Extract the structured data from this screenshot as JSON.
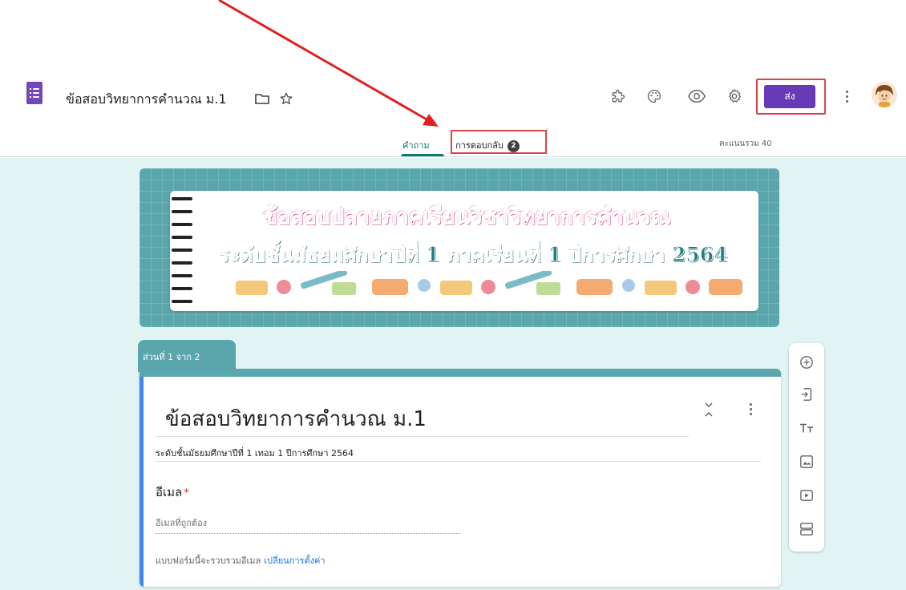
{
  "header": {
    "title": "ข้อสอบวิทยาการคำนวณ ม.1",
    "send_label": "ส่ง",
    "points_total": "คะแนนรวม 40"
  },
  "tabs": {
    "questions_label": "คำถาม",
    "responses_label": "การตอบกลับ",
    "responses_count": "2"
  },
  "banner": {
    "line1": "ข้อสอบปลายภาคเรียนวิชาวิทยาการคำนวณ",
    "line2": "ระดับชั้นมัธยมศึกษาปีที่ 1 ภาคเรียนที่ 1 ปีการศึกษา 2564"
  },
  "section": {
    "label": "ส่วนที่ 1 จาก 2"
  },
  "form": {
    "title": "ข้อสอบวิทยาการคำนวณ ม.1",
    "description": "ระดับชั้นมัธยมศึกษาปีที่ 1 เทอม 1 ปีการศึกษา 2564",
    "email_label": "อีเมล",
    "required_mark": "*",
    "email_placeholder": "อีเมลที่ถูกต้อง",
    "collect_note": "แบบฟอร์มนี้จะรวบรวมอีเมล",
    "change_settings": "เปลี่ยนการตั้งค่า"
  },
  "icons": {
    "app": "forms-icon",
    "folder": "folder-icon",
    "star": "star-icon",
    "addons": "puzzle-icon",
    "theme": "palette-icon",
    "preview": "eye-icon",
    "settings": "gear-icon",
    "more": "more-vert-icon"
  },
  "colors": {
    "accent": "#673ab7",
    "teal": "#5aa6ad",
    "annotation": "#e02020"
  }
}
